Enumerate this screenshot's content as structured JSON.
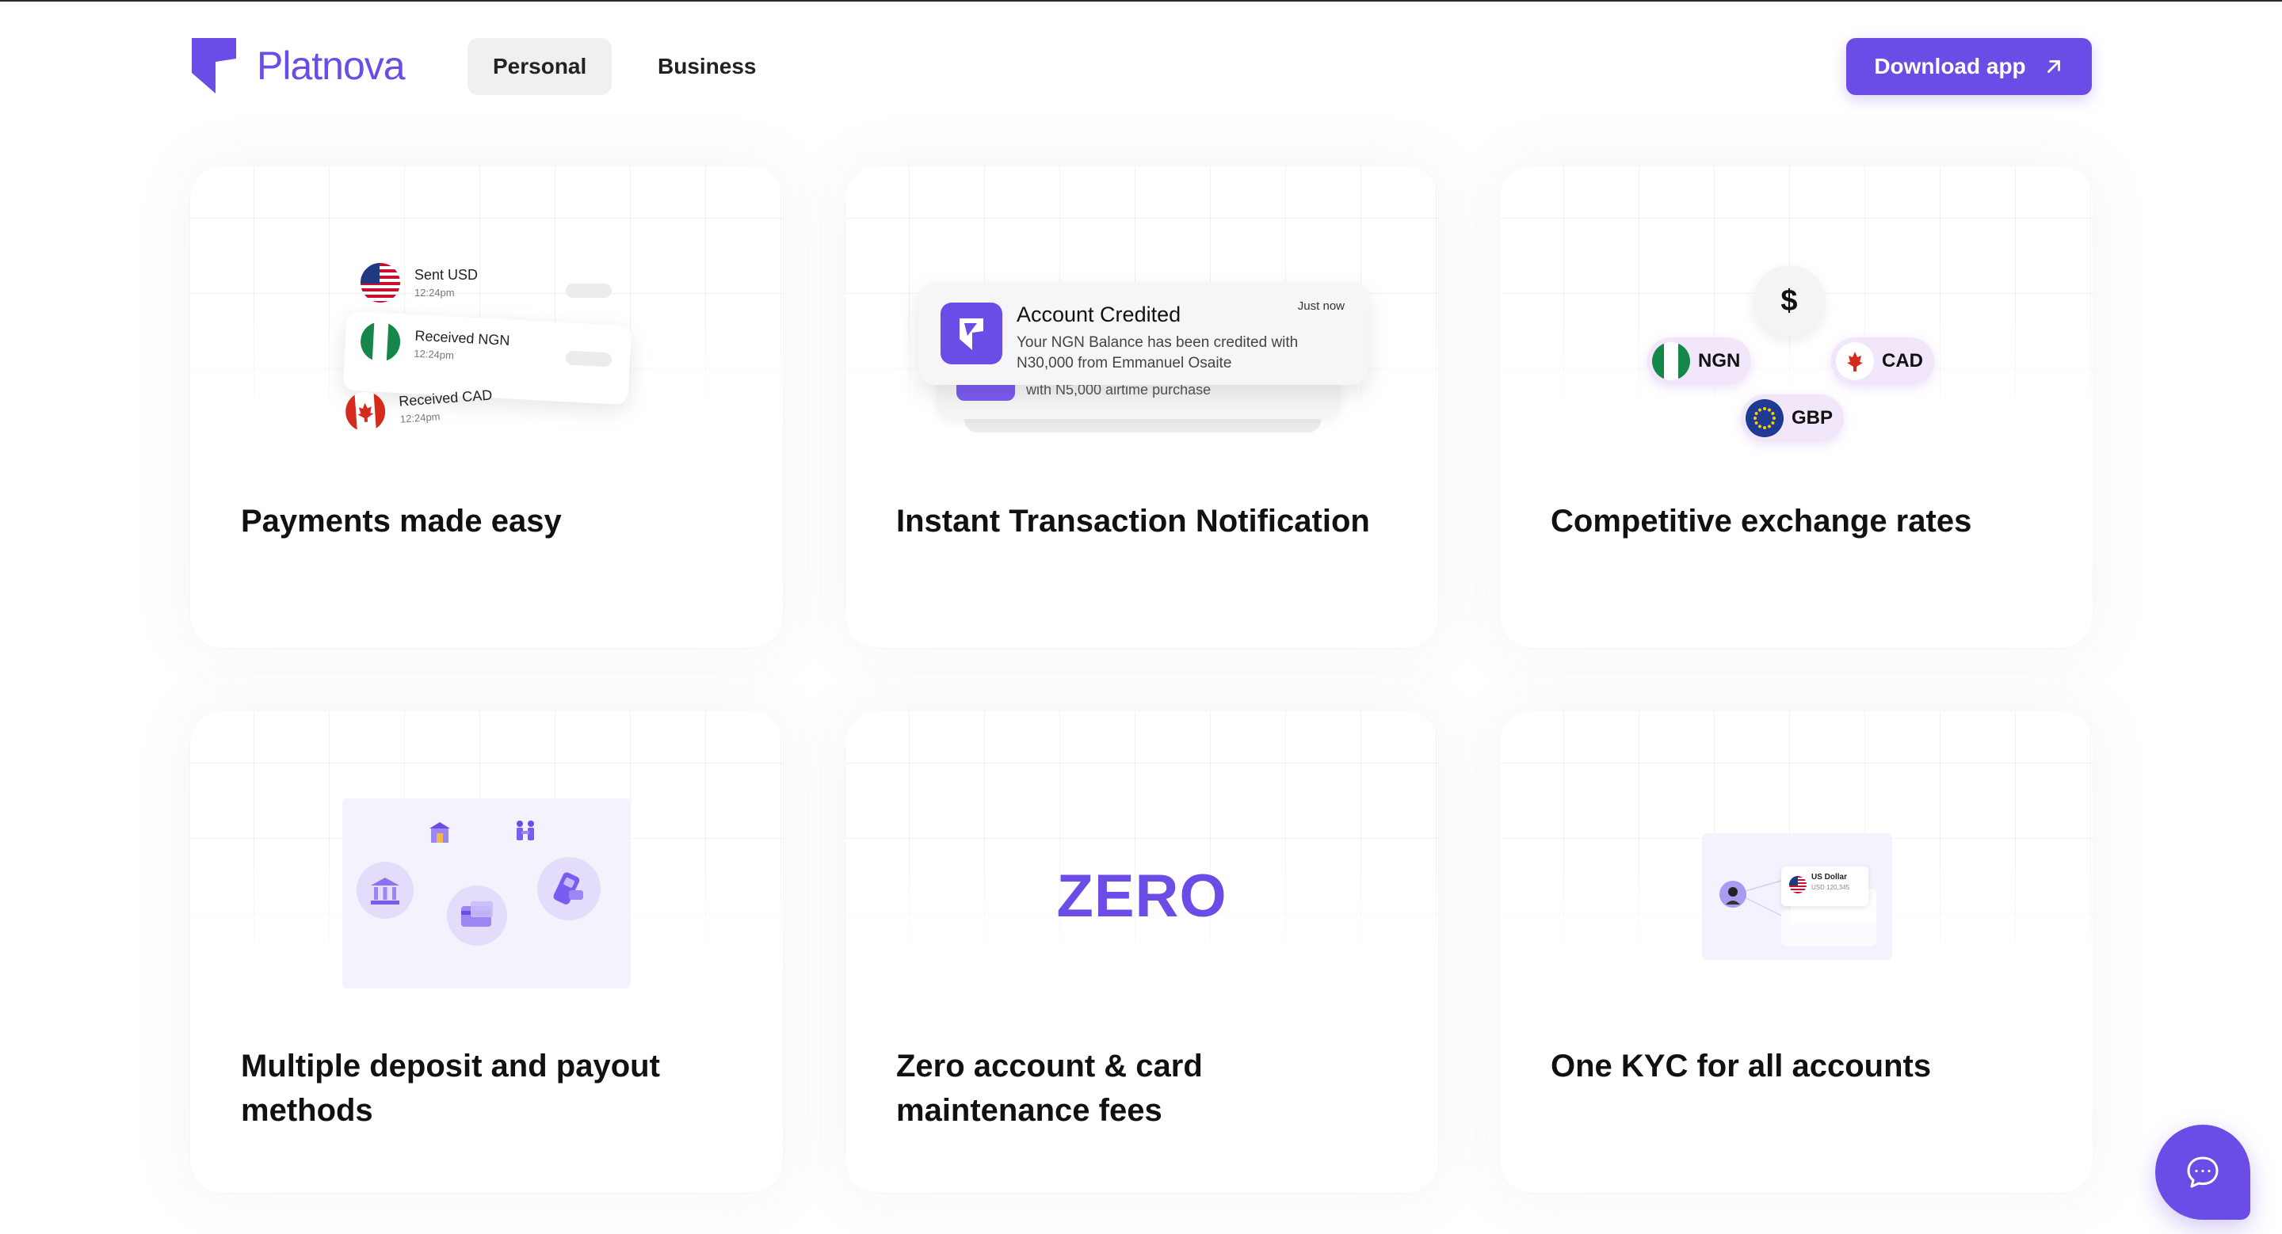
{
  "nav": {
    "logo_text": "Platnova",
    "tabs": [
      {
        "label": "Personal",
        "active": true
      },
      {
        "label": "Business",
        "active": false
      }
    ],
    "download_label": "Download app",
    "brand_color": "#6b4ce6"
  },
  "cards": [
    {
      "title": "Payments made easy",
      "transactions": [
        {
          "label": "Sent USD",
          "time": "12:24pm",
          "flag": "us-flag-icon"
        },
        {
          "label": "Received NGN",
          "time": "12:24pm",
          "flag": "ng-flag-icon"
        },
        {
          "label": "Received CAD",
          "time": "12:24pm",
          "flag": "ca-flag-icon"
        }
      ]
    },
    {
      "title": "Instant Transaction Notification",
      "notification": {
        "title": "Account Credited",
        "body": "Your NGN Balance has been credited with N30,000 from Emmanuel Osaite",
        "time": "Just now",
        "sub_text": "with N5,000 airtime purchase"
      }
    },
    {
      "title": "Competitive exchange rates",
      "symbol": "$",
      "currencies": [
        "NGN",
        "CAD",
        "GBP"
      ]
    },
    {
      "title": "Multiple deposit and payout methods"
    },
    {
      "title": "Zero account & card maintenance fees",
      "big_text": "ZERO"
    },
    {
      "title": "One KYC for all accounts",
      "kyc_card": {
        "label": "US Dollar",
        "sub": "USD 120,345"
      }
    }
  ],
  "chat": {
    "icon": "chat-bubble-icon"
  }
}
